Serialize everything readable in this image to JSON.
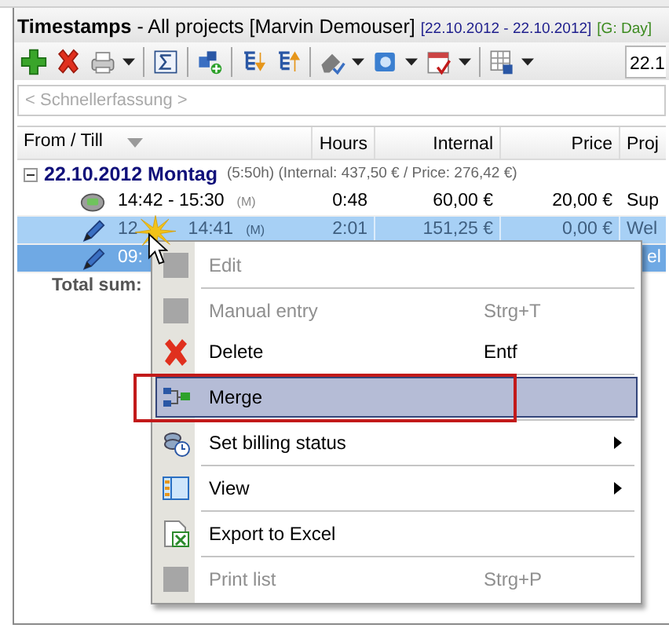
{
  "window": {
    "title": "Timestamps",
    "subtitle": "- All projects",
    "user": "[Marvin Demouser]",
    "date_range": "[22.10.2012 - 22.10.2012]",
    "grouping": "[G: Day]"
  },
  "toolbar": {
    "buttons": [
      {
        "kind": "add",
        "dropdown": false
      },
      {
        "kind": "delete",
        "dropdown": false
      },
      {
        "kind": "print",
        "dropdown": true
      },
      {
        "kind": "separator"
      },
      {
        "kind": "sum",
        "dropdown": false
      },
      {
        "kind": "separator"
      },
      {
        "kind": "blocks",
        "dropdown": false
      },
      {
        "kind": "separator"
      },
      {
        "kind": "treedown",
        "dropdown": false
      },
      {
        "kind": "treeup",
        "dropdown": false
      },
      {
        "kind": "separator"
      },
      {
        "kind": "edit",
        "dropdown": true
      },
      {
        "kind": "window",
        "dropdown": true
      },
      {
        "kind": "calendar",
        "dropdown": true
      },
      {
        "kind": "separator"
      },
      {
        "kind": "grid",
        "dropdown": true
      }
    ],
    "date_field": "22.1"
  },
  "quick_entry": {
    "placeholder": "< Schnellerfassung >"
  },
  "table": {
    "columns": [
      "From / Till",
      "Hours",
      "Internal",
      "Price",
      "Proj"
    ],
    "groups": [
      {
        "date": "22.10.2012 Montag",
        "summary": "(5:50h) (Internal: 437,50 € / Price: 276,42 €)",
        "expanded": true,
        "rows": [
          {
            "kind": "phone",
            "from": "14:42 - 15:30",
            "mark": "(M)",
            "hours": "0:48",
            "internal": "60,00 €",
            "price": "20,00 €",
            "project": "Sup",
            "selected": false,
            "focused": false
          },
          {
            "kind": "pen",
            "from": "12",
            "till": "14:41",
            "mark": "(M)",
            "hours": "2:01",
            "internal": "151,25 €",
            "price": "0,00 €",
            "project": "Wel",
            "selected": true,
            "focused": false
          },
          {
            "kind": "pen",
            "from": "09:",
            "project": "el",
            "selected": true,
            "focused": true
          }
        ]
      }
    ],
    "total_label": "Total sum:"
  },
  "context_menu": {
    "items": [
      {
        "kind": "blank",
        "label": "Edit",
        "disabled": true,
        "selected": false,
        "submenu": false
      },
      {
        "kind": "separator"
      },
      {
        "kind": "blank",
        "label": "Manual entry",
        "shortcut": "Strg+T",
        "disabled": true,
        "selected": false,
        "submenu": false
      },
      {
        "kind": "delete",
        "label": "Delete",
        "shortcut": "Entf",
        "disabled": false,
        "selected": false,
        "submenu": false
      },
      {
        "kind": "separator"
      },
      {
        "kind": "merge",
        "label": "Merge",
        "disabled": false,
        "selected": true,
        "submenu": false
      },
      {
        "kind": "separator"
      },
      {
        "kind": "billing",
        "label": "Set billing status",
        "disabled": false,
        "selected": false,
        "submenu": true
      },
      {
        "kind": "separator"
      },
      {
        "kind": "view",
        "label": "View",
        "disabled": false,
        "selected": false,
        "submenu": true
      },
      {
        "kind": "separator"
      },
      {
        "kind": "excel",
        "label": "Export to Excel",
        "disabled": false,
        "selected": false,
        "submenu": false
      },
      {
        "kind": "separator"
      },
      {
        "kind": "blank",
        "label": "Print list",
        "shortcut": "Strg+P",
        "disabled": true,
        "selected": false,
        "submenu": false
      }
    ]
  }
}
